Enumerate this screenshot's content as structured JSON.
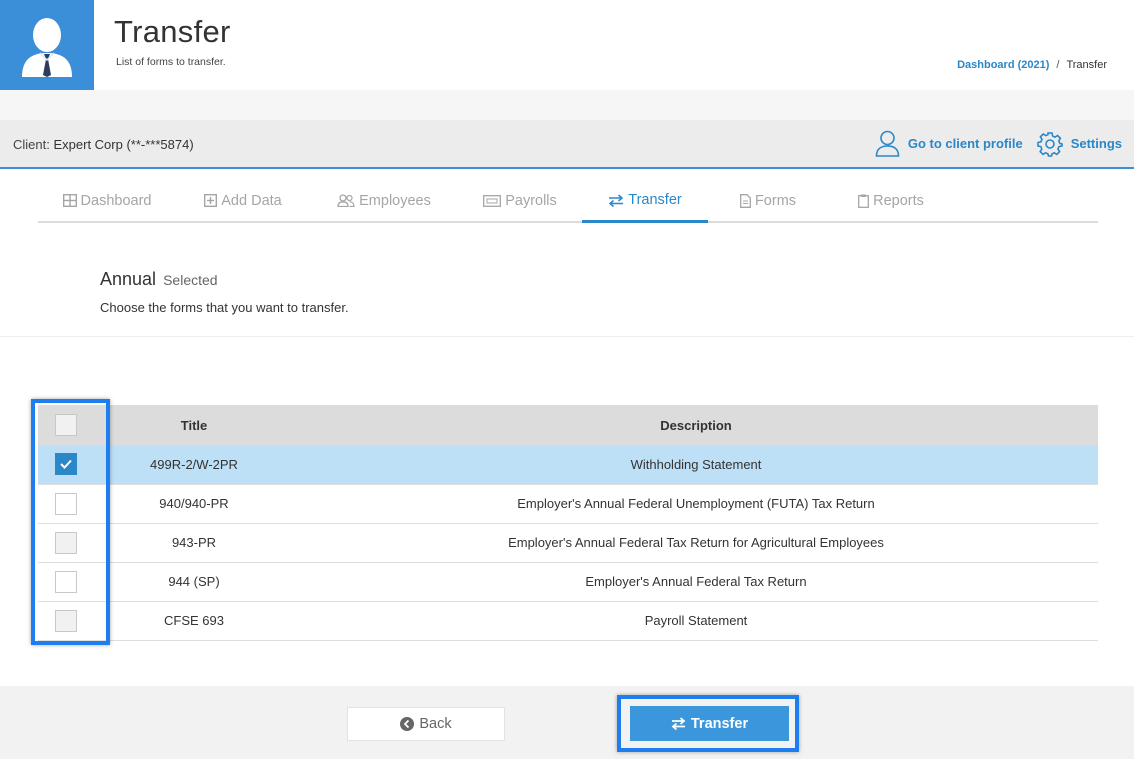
{
  "header": {
    "title": "Transfer",
    "subtitle": "List of forms to transfer.",
    "breadcrumb": [
      {
        "label": "Dashboard (2021)"
      },
      {
        "label": "Transfer"
      }
    ],
    "breadcrumb_separator": "/"
  },
  "client": {
    "label": "Client:",
    "name": "Expert Corp (**-***5874)",
    "profile_link": "Go to client profile",
    "settings_link": "Settings"
  },
  "tabs": [
    {
      "label": "Dashboard",
      "icon": "grid-icon"
    },
    {
      "label": "Add Data",
      "icon": "plus-square-icon"
    },
    {
      "label": "Employees",
      "icon": "users-icon"
    },
    {
      "label": "Payrolls",
      "icon": "money-icon"
    },
    {
      "label": "Transfer",
      "icon": "exchange-icon",
      "active": true
    },
    {
      "label": "Forms",
      "icon": "file-icon"
    },
    {
      "label": "Reports",
      "icon": "clipboard-icon"
    }
  ],
  "section": {
    "heading": "Annual",
    "heading_suffix": "Selected",
    "instruction": "Choose the forms that you want to transfer."
  },
  "table": {
    "columns": [
      "",
      "Title",
      "Description"
    ],
    "rows": [
      {
        "title": "499R-2/W-2PR",
        "description": "Withholding Statement",
        "checked": true
      },
      {
        "title": "940/940-PR",
        "description": "Employer's Annual Federal Unemployment (FUTA) Tax Return",
        "checked": false
      },
      {
        "title": "943-PR",
        "description": "Employer's Annual Federal Tax Return for Agricultural Employees",
        "checked": false
      },
      {
        "title": "944 (SP)",
        "description": "Employer's Annual Federal Tax Return",
        "checked": false
      },
      {
        "title": "CFSE 693",
        "description": "Payroll Statement",
        "checked": false
      }
    ]
  },
  "footer": {
    "back_label": "Back",
    "transfer_label": "Transfer"
  },
  "colors": {
    "accent": "#3b8fd8",
    "link": "#2a87c8",
    "selected_row": "#bde0f7",
    "highlight_frame": "#1e7ef0"
  }
}
